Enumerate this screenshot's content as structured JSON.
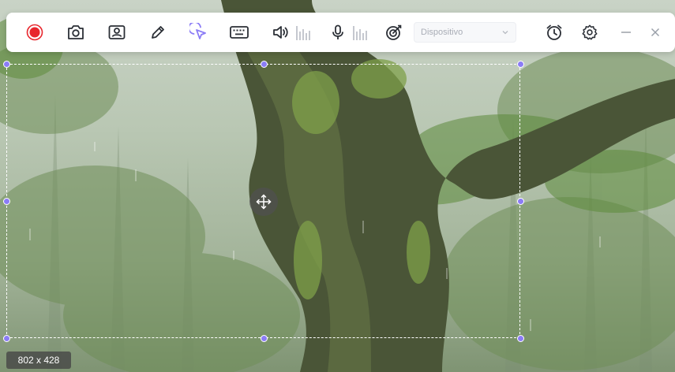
{
  "toolbar": {
    "buttons": {
      "record": {
        "icon": "record-icon",
        "color": "#e8262d"
      },
      "screenshot": {
        "icon": "camera-icon"
      },
      "webcam": {
        "icon": "webcam-icon"
      },
      "annotate": {
        "icon": "pen-icon"
      },
      "cursor": {
        "icon": "cursor-click-icon",
        "color": "#8b7cf6"
      },
      "keyboard": {
        "icon": "keyboard-icon"
      },
      "system_audio": {
        "icon": "speaker-icon"
      },
      "microphone": {
        "icon": "microphone-icon"
      },
      "effects": {
        "icon": "target-icon"
      },
      "schedule": {
        "icon": "alarm-clock-icon"
      },
      "settings": {
        "icon": "gear-icon"
      },
      "minimize": {
        "icon": "minimize-icon"
      },
      "close": {
        "icon": "close-icon"
      }
    },
    "device_select": {
      "value": "Dispositivo"
    }
  },
  "region": {
    "size_label": "802 x 428",
    "handle_color": "#8b7cf6"
  }
}
